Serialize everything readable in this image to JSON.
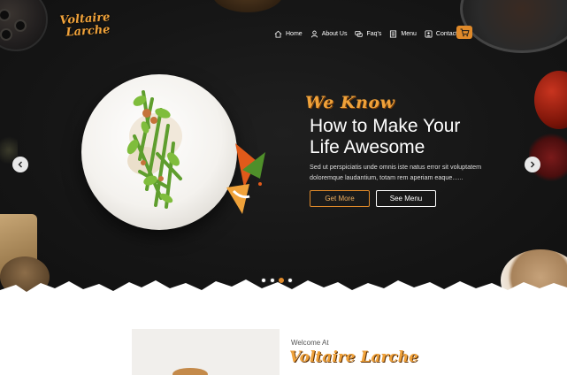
{
  "brand": {
    "logo_line1": "Voltaire",
    "logo_line2": "Larche",
    "accent_color": "#e08a2a"
  },
  "nav": {
    "items": [
      {
        "label": "Home",
        "icon": "home-icon"
      },
      {
        "label": "About Us",
        "icon": "user-icon"
      },
      {
        "label": "Faq's",
        "icon": "chat-icon"
      },
      {
        "label": "Menu",
        "icon": "menu-book-icon"
      },
      {
        "label": "Contact Us",
        "icon": "contact-icon"
      }
    ],
    "cart_icon": "cart-icon"
  },
  "hero": {
    "tagline": "We Know",
    "headline_line1": "How to Make Your",
    "headline_line2": "Life Awesome",
    "body_line1": "Sed ut perspiciatis unde omnis iste natus error sit voluptatem",
    "body_line2": "doloremque laudantium, totam rem aperiam eaque......",
    "primary_button": "Get More",
    "secondary_button": "See Menu",
    "slides_total": 4,
    "active_slide": 3
  },
  "about": {
    "welcome": "Welcome At",
    "brand_name": "Voltaire Larche"
  }
}
